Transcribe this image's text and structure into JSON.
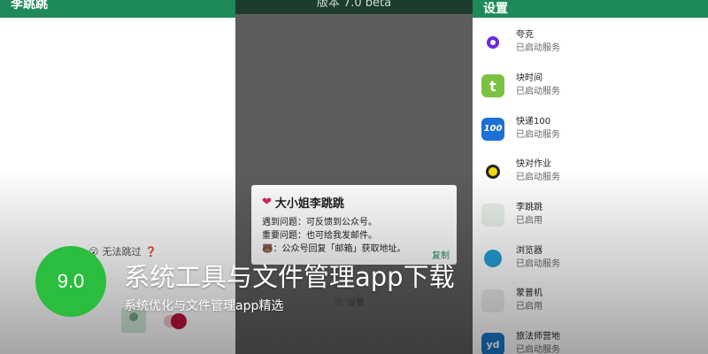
{
  "left_panel": {
    "title": "李跳跳",
    "no_jump_text": "无法跳过",
    "no_jump_emoji": "😮",
    "no_jump_mark": "❓"
  },
  "middle_panel": {
    "top_text": "版本 7.0 beta",
    "dialog": {
      "heart": "❤",
      "title": "大小姐李跳跳",
      "lines": [
        "遇到问题：可反馈到公众号。",
        "重要问题：也可给我发邮件。",
        "🐻：公众号回复「邮箱」获取地址。"
      ],
      "button": "复制"
    },
    "bottom_item": "设置"
  },
  "right_panel": {
    "title": "设置",
    "apps": [
      {
        "name": "夸克",
        "status": "已启动服务",
        "icon": "quark-icon"
      },
      {
        "name": "块时间",
        "status": "已启动服务",
        "icon": "kuai-time-icon",
        "glyph": "t"
      },
      {
        "name": "快递100",
        "status": "已启动服务",
        "icon": "kuaidi100-icon",
        "glyph": "100"
      },
      {
        "name": "快对作业",
        "status": "已启动服务",
        "icon": "kuaidui-icon"
      },
      {
        "name": "李跳跳",
        "status": "已启用",
        "icon": "lee-tiao-icon"
      },
      {
        "name": "浏览器",
        "status": "已启动服务",
        "icon": "browser-icon"
      },
      {
        "name": "蒙普机",
        "status": "已启用",
        "icon": "meng-icon"
      },
      {
        "name": "旅法师营地",
        "status": "已启动服务",
        "icon": "lvfashi-icon",
        "glyph": "yd"
      }
    ]
  },
  "overlay": {
    "score": "9.0",
    "headline": "系统工具与文件管理app下载",
    "subline": "系统优化与文件管理app精选"
  },
  "colors": {
    "accent_green": "#1e8a5a",
    "score_green": "#2bbd3e"
  }
}
